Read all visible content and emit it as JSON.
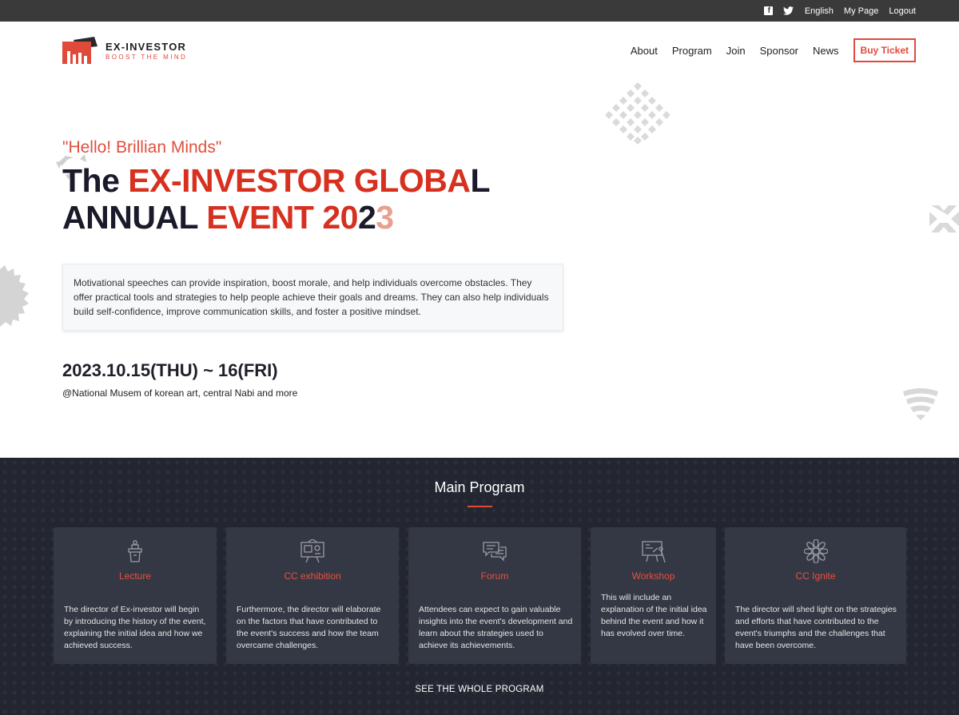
{
  "topbar": {
    "facebook_icon": "facebook-icon",
    "twitter_icon": "twitter-icon",
    "language": "English",
    "mypage": "My Page",
    "logout": "Logout"
  },
  "logo": {
    "name": "EX-INVESTOR",
    "tagline": "BOOST THE MIND"
  },
  "nav": {
    "items": [
      "About",
      "Program",
      "Join",
      "Sponsor",
      "News"
    ],
    "buy_label": "Buy Ticket"
  },
  "hero": {
    "hello": "\"Hello! Brillian Minds\"",
    "title_line1_a": "The ",
    "title_line1_b": "EX-INVESTOR GLOBA",
    "title_line1_c": "L",
    "title_line2_a": "ANNUAL ",
    "title_line2_b": "EVENT 20",
    "title_line2_c": "2",
    "title_line2_d": "3",
    "description": "Motivational speeches can provide inspiration, boost morale, and help individuals overcome obstacles. They offer practical tools and strategies to help people achieve their goals and dreams. They can also help individuals build self-confidence, improve communication skills, and foster a positive mindset.",
    "date": "2023.10.15(THU) ~ 16(FRI)",
    "venue": "@National Musem of korean art, central Nabi and more"
  },
  "program": {
    "heading": "Main Program",
    "cards": [
      {
        "title": "Lecture",
        "icon": "podium-icon",
        "text": "The director of Ex-investor will begin by introducing the history of the event, explaining the initial idea and how we achieved success."
      },
      {
        "title": "CC exhibition",
        "icon": "easel-icon",
        "text": "Furthermore, the director will elaborate on the factors that have contributed to the event's success and how the team overcame challenges."
      },
      {
        "title": "Forum",
        "icon": "chat-icon",
        "text": "Attendees can expect to gain valuable insights into the event's development and learn about the strategies used to achieve its achievements."
      },
      {
        "title": "Workshop",
        "icon": "presentation-icon",
        "text": "This will include an explanation of the initial idea behind the event and how it has evolved over time."
      },
      {
        "title": "CC Ignite",
        "icon": "flower-icon",
        "text": "The director will shed light on the strategies and efforts that have contributed to the event's triumphs and the challenges that have been overcome."
      }
    ],
    "see_all": "SEE THE WHOLE PROGRAM"
  },
  "colors": {
    "accent": "#e04a3a",
    "dark_section": "#232631",
    "card": "#343844",
    "topbar": "#3a3a3a"
  }
}
